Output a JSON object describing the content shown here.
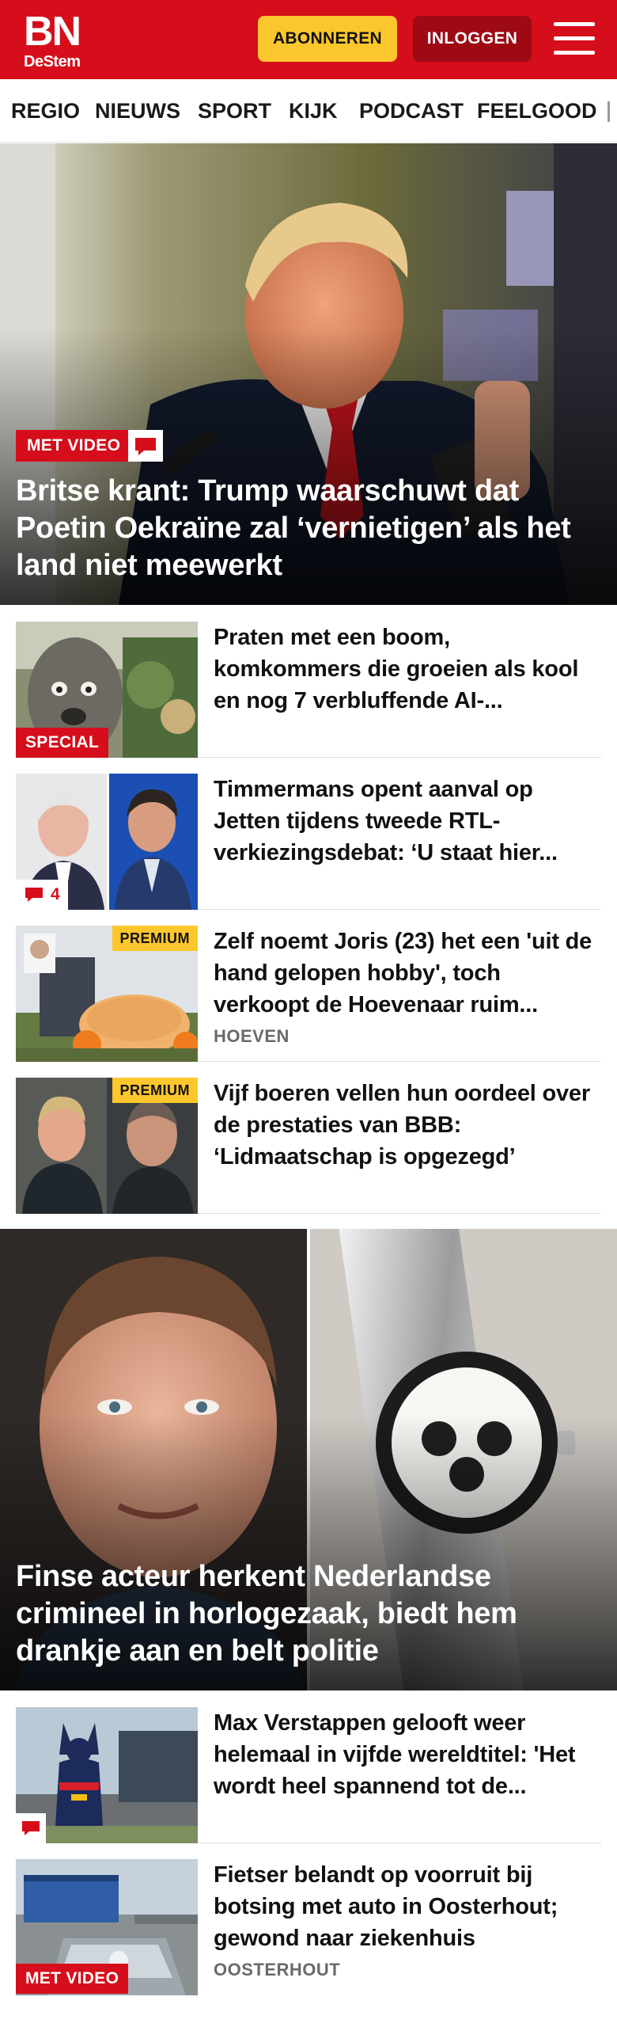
{
  "header": {
    "logo_main": "BN",
    "logo_sub": "DeStem",
    "subscribe_label": "ABONNEREN",
    "login_label": "INLOGGEN",
    "menu_icon": "hamburger-menu-icon",
    "colors": {
      "brand": "#d60e1b",
      "subscribe": "#fcc72c",
      "login": "#9d0a14"
    }
  },
  "nav": {
    "items": [
      "REGIO",
      "NIEUWS",
      "SPORT",
      "KIJK",
      "PODCAST",
      "FEELGOOD"
    ]
  },
  "hero1": {
    "badge": "MET VIDEO",
    "badge_icon": "comment-icon",
    "title": "Britse krant: Trump waarschuwt dat Poetin Oekraïne zal ‘vernietigen’ als het land niet meewerkt"
  },
  "articles": [
    {
      "title": "Praten met een boom, komkommers die groeien als kool en nog 7 verbluffende AI-...",
      "label": "SPECIAL"
    },
    {
      "title": "Timmermans opent aanval op Jetten tijdens tweede RTL-verkiezingsdebat: ‘U staat hier...",
      "comments": "4"
    },
    {
      "title": "Zelf noemt Joris (23) het een 'uit de hand gelopen hobby', toch verkoopt de Hoevenaar ruim...",
      "label": "PREMIUM",
      "location": "HOEVEN"
    },
    {
      "title": "Vijf boeren vellen hun oordeel over de prestaties van BBB: ‘Lidmaatschap is opgezegd’",
      "label": "PREMIUM"
    }
  ],
  "hero2": {
    "title": "Finse acteur herkent Nederlandse crimineel in horlogezaak, biedt hem drankje aan en belt politie"
  },
  "articles2": [
    {
      "title": "Max Verstappen gelooft weer helemaal in vijfde wereldtitel: 'Het wordt heel spannend tot de...",
      "comment_icon": "comment-icon"
    },
    {
      "title": "Fietser belandt op voorruit bij botsing met auto in Oosterhout; gewond naar ziekenhuis",
      "label": "MET VIDEO",
      "location": "OOSTERHOUT"
    }
  ]
}
